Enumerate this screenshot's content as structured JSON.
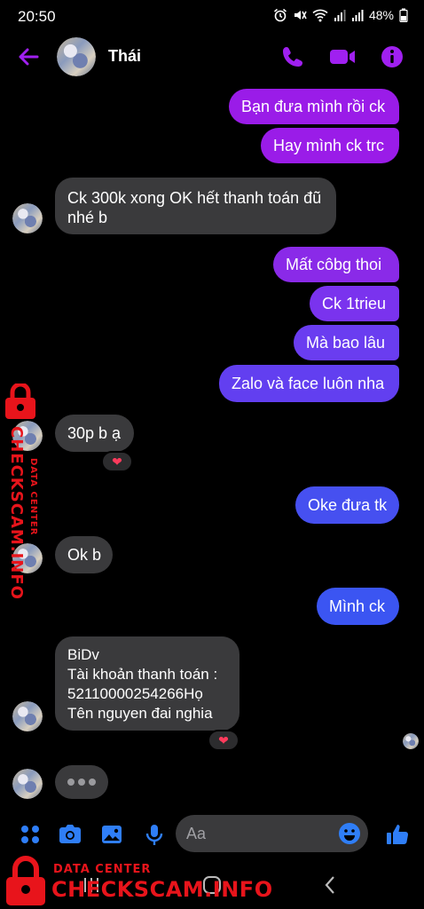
{
  "status_bar": {
    "time": "20:50",
    "battery": "48%",
    "icons": [
      "alarm-icon",
      "mute-icon",
      "wifi-icon",
      "signal-icon",
      "signal-icon",
      "battery-icon"
    ]
  },
  "header": {
    "contact_name": "Thái",
    "icons": [
      "back-arrow-icon",
      "phone-icon",
      "video-icon",
      "info-icon"
    ],
    "accent_color": "#a020f0"
  },
  "messages": [
    {
      "dir": "out",
      "text": "Bạn đưa mình rồi ck"
    },
    {
      "dir": "out",
      "text": "Hay mình ck trc"
    },
    {
      "dir": "in",
      "text": "Ck 300k xong OK hết thanh toán đũ nhé b"
    },
    {
      "dir": "out",
      "text": "Mất côbg thoi"
    },
    {
      "dir": "out",
      "text": "Ck 1trieu"
    },
    {
      "dir": "out",
      "text": "Mà bao lâu"
    },
    {
      "dir": "out",
      "text": "Zalo và face luôn nha"
    },
    {
      "dir": "in",
      "text": "30p b ạ",
      "reaction": "❤"
    },
    {
      "dir": "out",
      "text": "Oke đưa tk"
    },
    {
      "dir": "in",
      "text": "Ok b"
    },
    {
      "dir": "out",
      "text": "Mình ck"
    },
    {
      "dir": "in",
      "text": "BiDv\nTài khoản thanh toán :\n52110000254266Họ\nTên nguyen đai nghia",
      "reaction": "❤"
    }
  ],
  "composer": {
    "placeholder": "Aa",
    "icons": [
      "apps-grid-icon",
      "camera-icon",
      "image-icon",
      "microphone-icon",
      "emoji-icon",
      "thumbs-up-icon"
    ]
  },
  "navbar": {
    "icons": [
      "recent-apps-icon",
      "home-icon",
      "back-icon"
    ]
  },
  "watermark": {
    "brand": "CHECKSCAM.INFO",
    "sub": "DATA CENTER",
    "color": "#e8141b"
  },
  "colors": {
    "bubble_out_top": "#9a1ce8",
    "bubble_out_mid": "#6a3df0",
    "bubble_out_bottom": "#3b55f2",
    "bubble_in": "#3a3a3c"
  }
}
